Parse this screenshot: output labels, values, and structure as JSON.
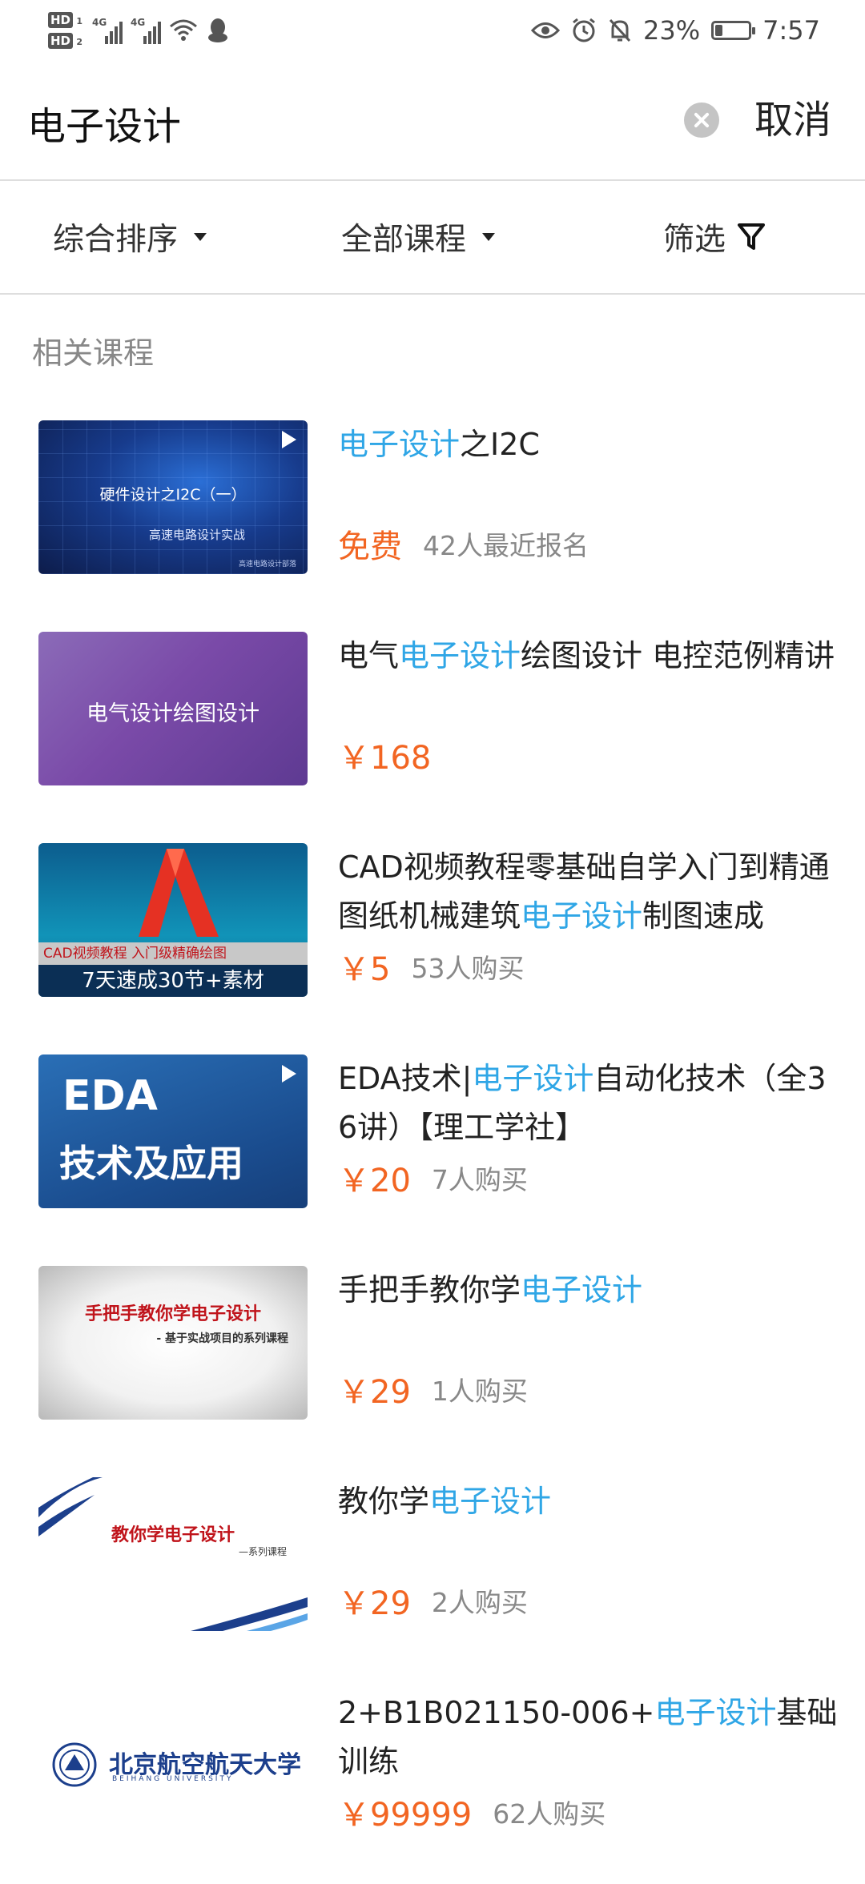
{
  "status_bar": {
    "hd1": "HD",
    "hd1_sub": "1",
    "hd2": "HD",
    "hd2_sub": "2",
    "network1": "4G",
    "network2": "4G",
    "battery_percent": "23%",
    "battery_level": 0.23,
    "time": "7:57",
    "icons": [
      "eye-icon",
      "alarm-icon",
      "mute-icon",
      "wifi-icon",
      "qq-icon"
    ]
  },
  "search": {
    "query": "电子设计",
    "cancel_label": "取消"
  },
  "filters": {
    "sort_label": "综合排序",
    "category_label": "全部课程",
    "filter_label": "筛选"
  },
  "section_title": "相关课程",
  "courses": [
    {
      "title_parts": [
        {
          "text": "电子设计",
          "hl": true
        },
        {
          "text": "之I2C",
          "hl": false
        }
      ],
      "price": "免费",
      "count": "42人最近报名",
      "thumb_title": "硬件设计之I2C（一）",
      "thumb_subtitle": "高速电路设计实战",
      "thumb_footnote": "高速电路设计部落"
    },
    {
      "title_parts": [
        {
          "text": "电气",
          "hl": false
        },
        {
          "text": "电子设计",
          "hl": true
        },
        {
          "text": "绘图设计 电控范例精讲",
          "hl": false
        }
      ],
      "price": "￥168",
      "count": "",
      "thumb_title": "电气设计绘图设计"
    },
    {
      "title_parts": [
        {
          "text": "CAD视频教程零基础自学入门到精通图纸机械建筑",
          "hl": false
        },
        {
          "text": "电子设计",
          "hl": true
        },
        {
          "text": "制图速成",
          "hl": false
        }
      ],
      "price": "￥5",
      "count": "53人购买",
      "thumb_banner": "CAD视频教程 入门级精确绘图",
      "thumb_footer": "7天速成30节+素材"
    },
    {
      "title_parts": [
        {
          "text": "EDA技术|",
          "hl": false
        },
        {
          "text": "电子设计",
          "hl": true
        },
        {
          "text": "自动化技术（全36讲）【理工学社】",
          "hl": false
        }
      ],
      "price": "￥20",
      "count": "7人购买",
      "thumb_line1": "EDA",
      "thumb_line2": "技术及应用"
    },
    {
      "title_parts": [
        {
          "text": "手把手教你学",
          "hl": false
        },
        {
          "text": "电子设计",
          "hl": true
        }
      ],
      "price": "￥29",
      "count": "1人购买",
      "thumb_title": "手把手教你学电子设计",
      "thumb_subtitle": "- 基于实战项目的系列课程"
    },
    {
      "title_parts": [
        {
          "text": "教你学",
          "hl": false
        },
        {
          "text": "电子设计",
          "hl": true
        }
      ],
      "price": "￥29",
      "count": "2人购买",
      "thumb_title": "教你学电子设计",
      "thumb_subtitle": "—系列课程"
    },
    {
      "title_parts": [
        {
          "text": "2+B1B021150-006+",
          "hl": false
        },
        {
          "text": "电子设计",
          "hl": true
        },
        {
          "text": "基础训练",
          "hl": false
        }
      ],
      "price": "￥99999",
      "count": "62人购买",
      "thumb_title": "北京航空航天大学",
      "thumb_subtitle": "BEIHANG UNIVERSITY"
    }
  ],
  "colors": {
    "highlight": "#2fa6e6",
    "price": "#f26522",
    "muted": "#888888"
  }
}
